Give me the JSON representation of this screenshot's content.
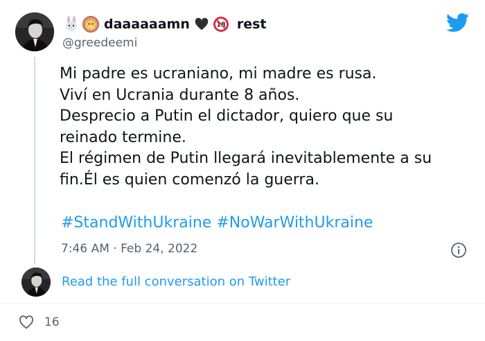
{
  "author": {
    "display_name": "daaaaaamn",
    "name_tail": "rest",
    "handle": "@greedeemi",
    "name_emojis": [
      "rabbit-face",
      "lion-face",
      "black-heart",
      "no-one-under-eighteen"
    ],
    "badge_18_text": "18"
  },
  "tweet": {
    "lines": [
      "Mi padre es ucraniano, mi madre es rusa.",
      "Viví en Ucrania durante 8 años.",
      "Desprecio a Putin el dictador, quiero que su",
      "reinado termine.",
      "El régimen de Putin llegará inevitablemente a su",
      "fin.Él es quien comenzó la guerra."
    ],
    "hashtags": [
      "#StandWithUkraine",
      "#NoWarWithUkraine"
    ],
    "timestamp": "7:46 AM · Feb 24, 2022"
  },
  "footer": {
    "read_conversation": "Read the full conversation on Twitter",
    "like_count": "16"
  },
  "colors": {
    "link_blue": "#1d9bf0",
    "twitter_blue": "#1d9bf0",
    "secondary_text": "#536471",
    "primary_text": "#0f1419",
    "thread_line": "#cfd9de",
    "badge_red": "#f91880"
  },
  "icons": [
    "twitter-bird-icon",
    "info-icon",
    "heart-icon"
  ]
}
